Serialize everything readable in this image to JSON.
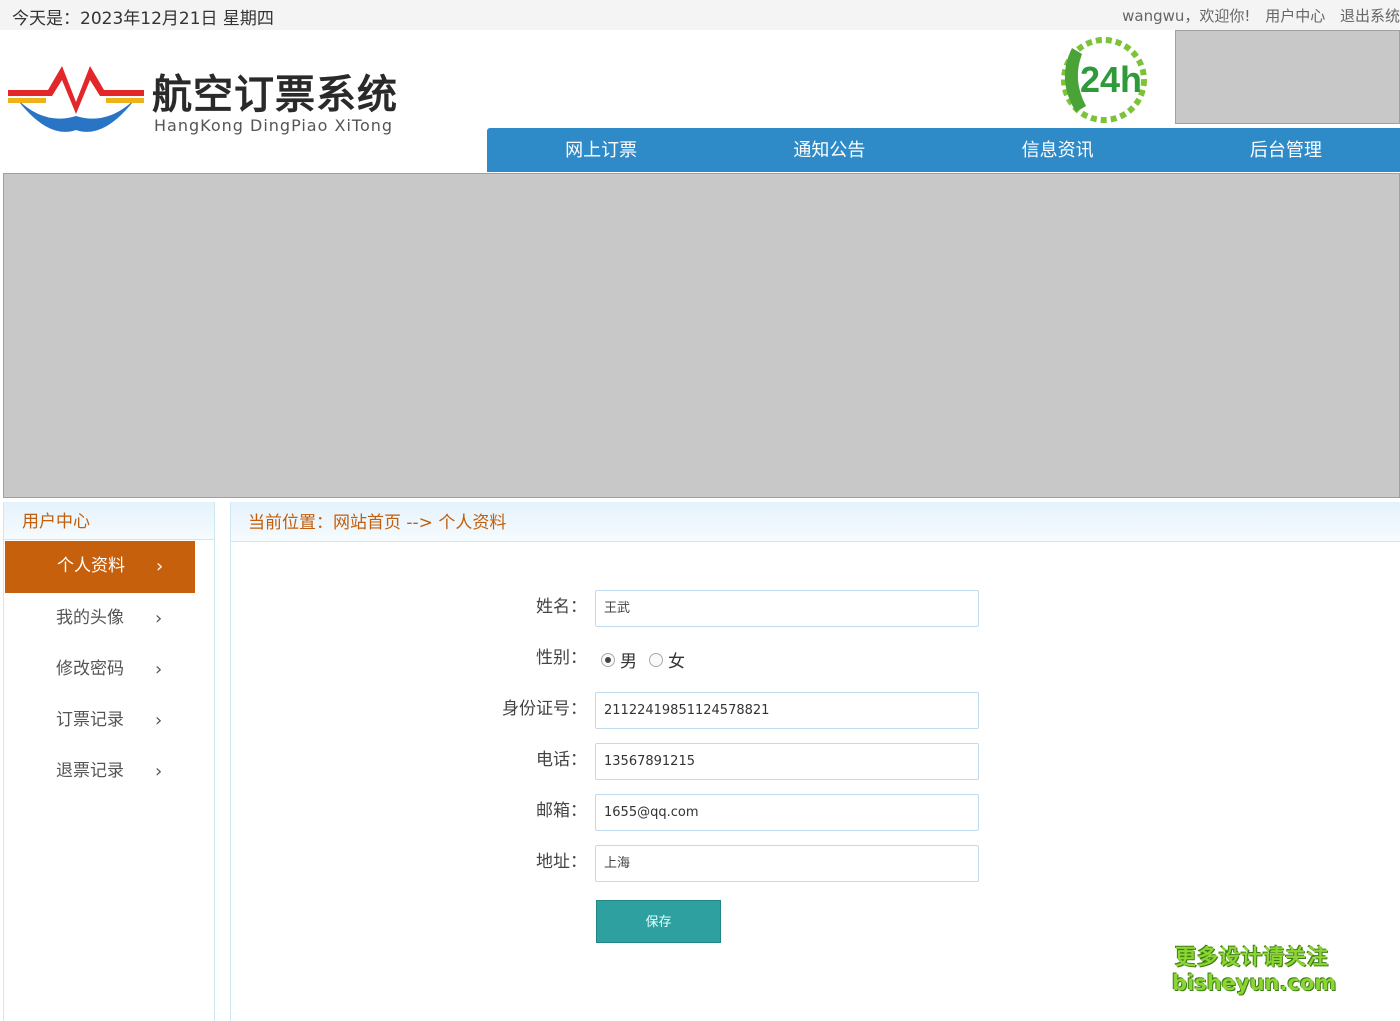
{
  "topbar": {
    "date": "今天是：2023年12月21日 星期四",
    "welcome": "wangwu，欢迎你!",
    "user_center": "用户中心",
    "logout": "退出系统"
  },
  "brand": {
    "title": "航空订票系统",
    "subtitle": "HangKong DingPiao XiTong",
    "badge": "24h",
    "colors": {
      "red": "#e3262a",
      "blue": "#2a74c6",
      "yellow": "#f0b21a"
    }
  },
  "nav": {
    "items": [
      "网上订票",
      "通知公告",
      "信息资讯",
      "后台管理"
    ],
    "color": "#2f8bc8"
  },
  "sidebar": {
    "title": "用户中心",
    "items": [
      "个人资料",
      "我的头像",
      "修改密码",
      "订票记录",
      "退票记录"
    ],
    "active_index": 0,
    "active_color": "#c7600d"
  },
  "breadcrumb": {
    "text": "当前位置：网站首页 --> 个人资料"
  },
  "form": {
    "name_label": "姓名：",
    "name_value": "王武",
    "gender_label": "性别：",
    "gender_options": [
      "男",
      "女"
    ],
    "gender_selected": "男",
    "idcard_label": "身份证号：",
    "idcard_value": "211224198511245788​21",
    "phone_label": "电话：",
    "phone_value": "13567891215",
    "email_label": "邮箱：",
    "email_value": "1655@qq.com",
    "address_label": "地址：",
    "address_value": "上海",
    "save_label": "保存",
    "save_color": "#2fa0a0"
  },
  "watermark": {
    "line1": "更多设计请关注",
    "line2": "bisheyun.com"
  }
}
